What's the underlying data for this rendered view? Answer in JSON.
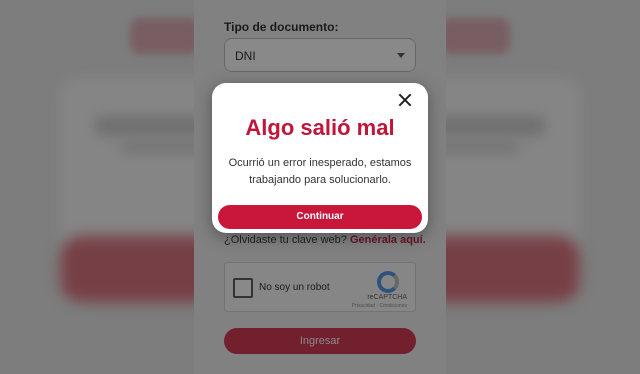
{
  "form": {
    "doc_type_label": "Tipo de documento:",
    "doc_type_value": "DNI",
    "forgot_text": "¿Olvidaste tu clave web?",
    "forgot_link": "Genérala aquí.",
    "submit_label": "Ingresar"
  },
  "captcha": {
    "label": "No soy un robot",
    "brand": "reCAPTCHA",
    "terms": "Privacidad - Condiciones"
  },
  "modal": {
    "title": "Algo salió mal",
    "message_line1": "Ocurrió un error inesperado, estamos",
    "message_line2": "trabajando para solucionarlo.",
    "button_label": "Continuar",
    "close_icon": "close-icon"
  },
  "colors": {
    "brand_red": "#c0163a",
    "button_red": "#c8173b"
  }
}
